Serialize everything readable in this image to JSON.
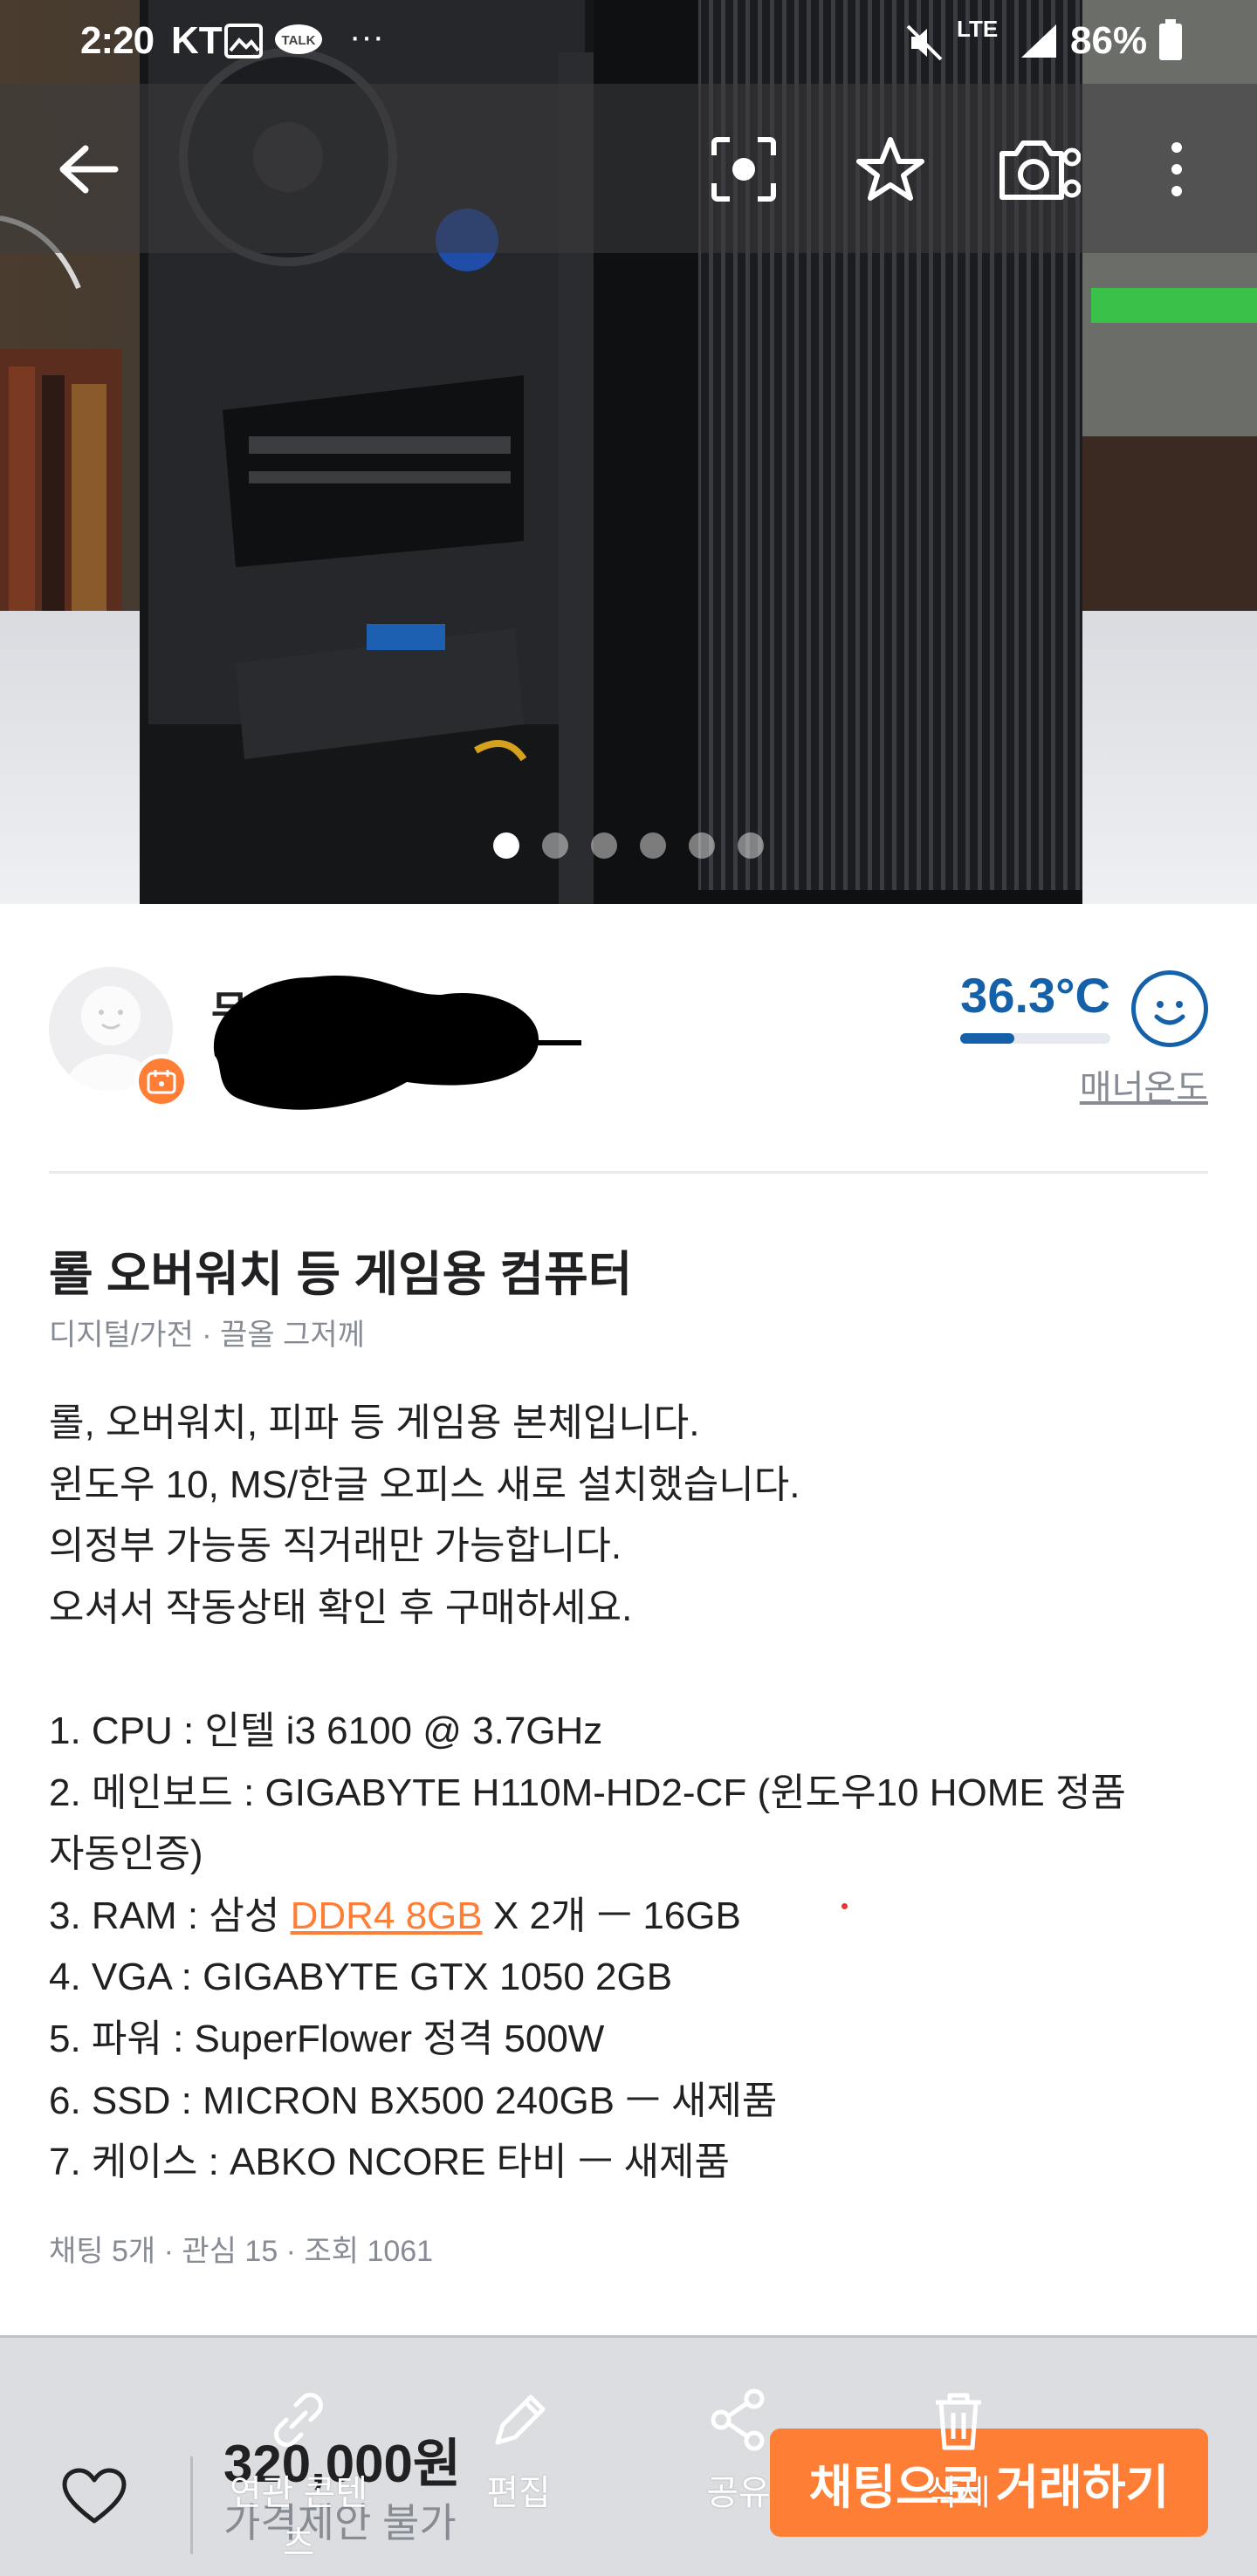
{
  "status_bar": {
    "time": "2:20",
    "carrier": "KT",
    "battery": "86%"
  },
  "photo": {
    "dots_total": 6,
    "dots_active": 0
  },
  "seller": {
    "name_initial": "무",
    "temperature": "36.3°C",
    "temperature_fill": 0.36,
    "manner_label": "매너온도"
  },
  "article": {
    "title": "롤 오버워치 등 게임용 컴퓨터",
    "meta": "디지털/가전 · 끌올 그저께",
    "description_lines": [
      [
        "롤, 오버워치, 피파 등 게임용 본체입니다."
      ],
      [
        "윈도우 10, MS/한글 오피스 새로 설치했습니다."
      ],
      [
        "의정부 가능동 직거래만 가능합니다."
      ],
      [
        "오셔서 작동상태 확인 후 구매하세요."
      ],
      [
        ""
      ],
      [
        "1. CPU : 인텔 i3 6100 @ 3.7GHz"
      ],
      [
        "2. 메인보드 : GIGABYTE H110M-HD2-CF (윈도우10 HOME 정품"
      ],
      [
        "자동인증)"
      ],
      [
        "3. RAM : 삼성 ",
        "DDR4 8GB",
        " X 2개 ㅡ 16GB"
      ],
      [
        "4. VGA : GIGABYTE GTX 1050 2GB"
      ],
      [
        "5. 파워 : SuperFlower 정격 500W"
      ],
      [
        "6. SSD : MICRON BX500 240GB ㅡ 새제품"
      ],
      [
        "7. 케이스 : ABKO NCORE 타비 ㅡ 새제품"
      ]
    ],
    "stats": "채팅 5개 · 관심 15 · 조회 1061"
  },
  "bottom_bar": {
    "price": "320,000원",
    "price_note": "가격제안 불가",
    "chat_button": "채팅으로 거래하기"
  },
  "overlay_tools": [
    {
      "label": "연관 콘텐츠",
      "icon": "link-icon"
    },
    {
      "label": "편집",
      "icon": "pencil-icon"
    },
    {
      "label": "공유",
      "icon": "share-icon"
    },
    {
      "label": "삭제",
      "icon": "trash-icon"
    }
  ],
  "colors": {
    "accent": "#ff7e36",
    "temperature": "#1561a9",
    "muted": "#868b94"
  }
}
